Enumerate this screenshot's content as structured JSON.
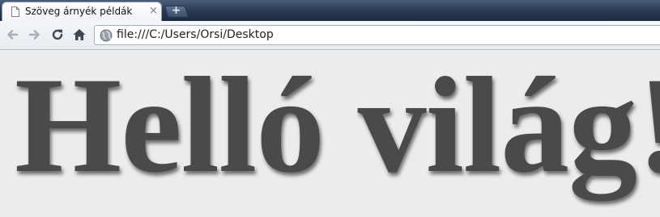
{
  "browser": {
    "tab": {
      "title": "Szöveg árnyék példák",
      "close_label": "×"
    },
    "new_tab_label": "+",
    "toolbar": {
      "back_icon": "arrow-left-icon",
      "forward_icon": "arrow-right-icon",
      "reload_icon": "reload-icon",
      "home_icon": "home-icon"
    },
    "address_bar": {
      "url": "file:///C:/Users/Orsi/Desktop",
      "site_icon": "globe-icon"
    }
  },
  "page": {
    "heading": "Helló világ!",
    "heading_color": "#4a4a4a",
    "background_color": "#ececec"
  }
}
